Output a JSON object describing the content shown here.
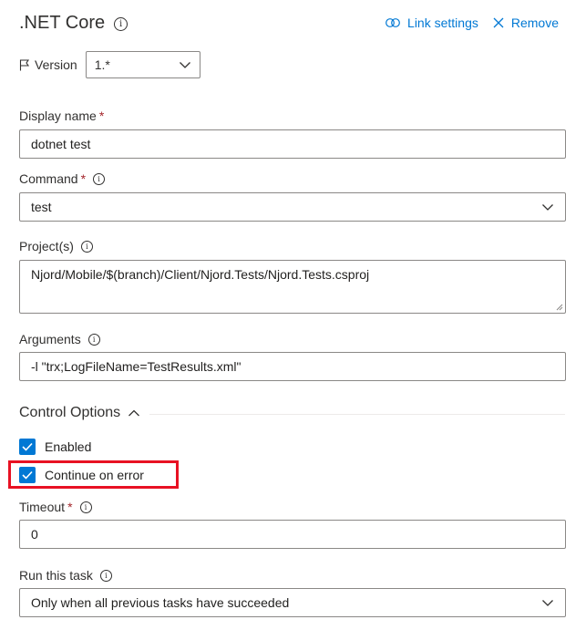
{
  "header": {
    "title": ".NET Core",
    "link_settings": "Link settings",
    "remove": "Remove"
  },
  "version": {
    "label": "Version",
    "value": "1.*"
  },
  "fields": {
    "display_name": {
      "label": "Display name",
      "value": "dotnet test"
    },
    "command": {
      "label": "Command",
      "value": "test"
    },
    "projects": {
      "label": "Project(s)",
      "value": "Njord/Mobile/$(branch)/Client/Njord.Tests/Njord.Tests.csproj"
    },
    "arguments": {
      "label": "Arguments",
      "value": "-l \"trx;LogFileName=TestResults.xml\""
    }
  },
  "control_options": {
    "title": "Control Options",
    "enabled": {
      "label": "Enabled",
      "checked": true
    },
    "continue_on_error": {
      "label": "Continue on error",
      "checked": true
    },
    "timeout": {
      "label": "Timeout",
      "value": "0"
    },
    "run_this_task": {
      "label": "Run this task",
      "value": "Only when all previous tasks have succeeded"
    }
  },
  "colors": {
    "accent": "#0078d4",
    "required": "#a4262c",
    "highlight": "#e81123"
  },
  "icons": {
    "title_info": "info-icon",
    "link": "link-icon",
    "remove": "close-icon",
    "version": "flag-icon",
    "dropdown": "chevron-down-icon",
    "section_toggle": "chevron-up-icon",
    "checkbox": "checkmark-icon"
  }
}
